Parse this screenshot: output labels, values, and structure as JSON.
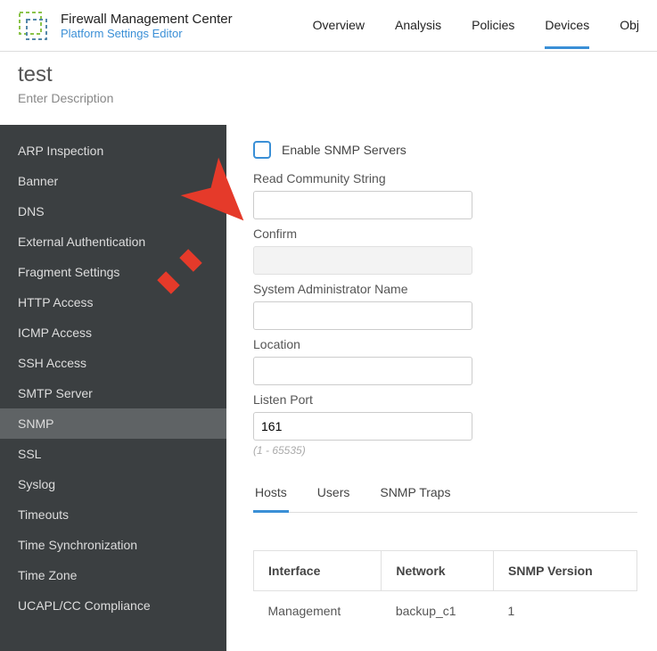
{
  "header": {
    "brand_title": "Firewall Management Center",
    "brand_sub": "Platform Settings Editor",
    "nav": [
      "Overview",
      "Analysis",
      "Policies",
      "Devices",
      "Obj"
    ],
    "nav_active_index": 3
  },
  "page": {
    "title": "test",
    "description": "Enter Description"
  },
  "sidebar": {
    "items": [
      "ARP Inspection",
      "Banner",
      "DNS",
      "External Authentication",
      "Fragment Settings",
      "HTTP Access",
      "ICMP Access",
      "SSH Access",
      "SMTP Server",
      "SNMP",
      "SSL",
      "Syslog",
      "Timeouts",
      "Time Synchronization",
      "Time Zone",
      "UCAPL/CC Compliance"
    ],
    "selected_index": 9
  },
  "form": {
    "enable_label": "Enable SNMP Servers",
    "read_community_label": "Read Community String",
    "read_community_value": "",
    "confirm_label": "Confirm",
    "confirm_value": "",
    "sysadmin_label": "System Administrator Name",
    "sysadmin_value": "",
    "location_label": "Location",
    "location_value": "",
    "listen_port_label": "Listen Port",
    "listen_port_value": "161",
    "listen_port_hint": "(1 - 65535)"
  },
  "tabs": {
    "items": [
      "Hosts",
      "Users",
      "SNMP Traps"
    ],
    "active_index": 0
  },
  "table": {
    "headers": [
      "Interface",
      "Network",
      "SNMP Version"
    ],
    "rows": [
      {
        "interface": "Management",
        "network": "backup_c1",
        "version": "1"
      }
    ]
  }
}
